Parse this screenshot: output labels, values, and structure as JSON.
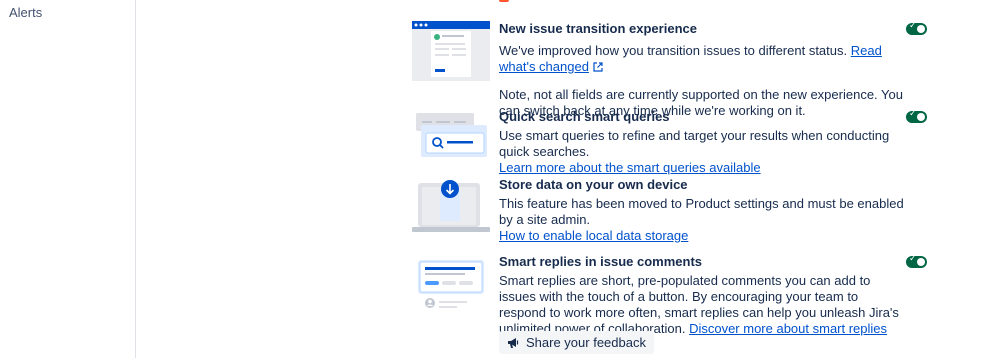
{
  "sidebar": {
    "items": [
      {
        "label": "Alerts"
      }
    ]
  },
  "features": [
    {
      "title": "New issue transition experience",
      "desc_line1": "We've improved how you transition issues to different status.",
      "link": "Read what's changed",
      "desc_line2": "Note, not all fields are currently supported on the new experience. You can switch back at any time while we're working on it.",
      "toggle": "on"
    },
    {
      "title": "Quick search smart queries",
      "desc": "Use smart queries to refine and target your results when conducting quick searches.",
      "link": "Learn more about the smart queries available",
      "toggle": "on"
    },
    {
      "title": "Store data on your own device",
      "desc": "This feature has been moved to Product settings and must be enabled by a site admin.",
      "link": "How to enable local data storage"
    },
    {
      "title": "Smart replies in issue comments",
      "desc": "Smart replies are short, pre-populated comments you can add to issues with the touch of a button. By encouraging your team to respond to work more often, smart replies can help you unleash Jira's unlimited power of collaboration.",
      "link": "Discover more about smart replies",
      "toggle": "on",
      "feedback_label": "Share your feedback"
    }
  ],
  "colors": {
    "toggle_on": "#006644",
    "link": "#0052cc",
    "accent": "#0052cc"
  }
}
